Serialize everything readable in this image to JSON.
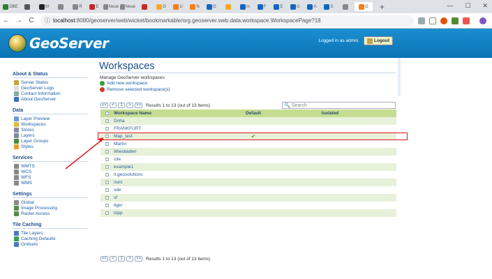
{
  "browser": {
    "tabs": [
      {
        "label": "DBE",
        "color": "#2e7d32"
      },
      {
        "label": "",
        "color": "#555"
      },
      {
        "label": "M",
        "color": "#222"
      },
      {
        "label": "",
        "color": "#888"
      },
      {
        "label": "R",
        "color": "#888"
      },
      {
        "label": "E",
        "color": "#c62828"
      },
      {
        "label": "Neue",
        "color": "#888"
      },
      {
        "label": "Neue",
        "color": "#888"
      },
      {
        "label": "",
        "color": "#c62828"
      },
      {
        "label": "D",
        "color": "#f9a825"
      },
      {
        "label": "U",
        "color": "#f57f17"
      },
      {
        "label": "N",
        "color": "#f57f17"
      },
      {
        "label": "G",
        "color": "#1565c0"
      },
      {
        "label": "",
        "color": "#f9a825"
      },
      {
        "label": "m",
        "color": "#1565c0"
      },
      {
        "label": "F",
        "color": "#1565c0"
      },
      {
        "label": "E",
        "color": "#1565c0"
      },
      {
        "label": "G",
        "color": "#1565c0"
      },
      {
        "label": "A",
        "color": "#1565c0"
      },
      {
        "label": "S",
        "color": "#1565c0"
      },
      {
        "label": "",
        "color": "#888"
      },
      {
        "label": "G",
        "color": "#f57f17"
      }
    ],
    "active_tab_label": "",
    "new_tab": "+",
    "window_controls": [
      "—",
      "☐",
      "✕"
    ],
    "nav": {
      "back": "←",
      "forward": "→",
      "reload": "C"
    },
    "url_host": "localhost",
    "url_rest": ":8080/geoserver/web/wicket/bookmarkable/org.geoserver.web.data.workspace.WorkspacePage?18"
  },
  "header": {
    "brand": "GeoServer",
    "login_text": "Logged in as admin.",
    "logout_label": "Logout"
  },
  "sidebar": {
    "sections": [
      {
        "title": "About & Status",
        "items": [
          {
            "label": "Server Status",
            "icon": "server-icon",
            "color": "#c8a040"
          },
          {
            "label": "GeoServer Logs",
            "icon": "log-icon",
            "color": "#ddd"
          },
          {
            "label": "Contact Information",
            "icon": "contact-icon",
            "color": "#8aa"
          },
          {
            "label": "About GeoServer",
            "icon": "info-icon",
            "color": "#3a6ec0"
          }
        ]
      },
      {
        "title": "Data",
        "items": [
          {
            "label": "Layer Preview",
            "icon": "preview-icon",
            "color": "#6a9ad0"
          },
          {
            "label": "Workspaces",
            "icon": "folder-icon",
            "color": "#e0b840"
          },
          {
            "label": "Stores",
            "icon": "store-icon",
            "color": "#8a8aa0"
          },
          {
            "label": "Layers",
            "icon": "layers-icon",
            "color": "#7a8aa0"
          },
          {
            "label": "Layer Groups",
            "icon": "layer-group-icon",
            "color": "#4a8a3a"
          },
          {
            "label": "Styles",
            "icon": "styles-icon",
            "color": "#e0a030"
          }
        ]
      },
      {
        "title": "Services",
        "items": [
          {
            "label": "WMTS",
            "icon": "service-icon",
            "color": "#888"
          },
          {
            "label": "WCS",
            "icon": "service-icon",
            "color": "#888"
          },
          {
            "label": "WFS",
            "icon": "service-icon",
            "color": "#888"
          },
          {
            "label": "WMS",
            "icon": "service-icon",
            "color": "#888"
          }
        ]
      },
      {
        "title": "Settings",
        "items": [
          {
            "label": "Global",
            "icon": "global-icon",
            "color": "#888"
          },
          {
            "label": "Image Processing",
            "icon": "image-icon",
            "color": "#5a8a4a"
          },
          {
            "label": "Raster Access",
            "icon": "raster-icon",
            "color": "#5a8a4a"
          }
        ]
      },
      {
        "title": "Tile Caching",
        "items": [
          {
            "label": "Tile Layers",
            "icon": "tile-icon",
            "color": "#4a7ac0"
          },
          {
            "label": "Caching Defaults",
            "icon": "globe-icon",
            "color": "#3a9a5a"
          },
          {
            "label": "Gridsets",
            "icon": "grid-icon",
            "color": "#4a7ac0"
          }
        ]
      }
    ]
  },
  "main": {
    "title": "Workspaces",
    "description": "Manage GeoServer workspaces",
    "add_label": "Add new workspace",
    "remove_label": "Remove selected workspace(s)",
    "pager": {
      "first": "<<",
      "prev": "<",
      "page": "1",
      "next": ">",
      "last": ">>",
      "summary": "Results 1 to 13 (out of 13 items)"
    },
    "search_placeholder": "Search",
    "columns": {
      "name": "Workspace Name",
      "default": "Default",
      "isolated": "Isolated"
    },
    "rows": [
      {
        "name": "Doha",
        "default": ""
      },
      {
        "name": "FRANKFURT",
        "default": ""
      },
      {
        "name": "Map_test",
        "default": "✔"
      },
      {
        "name": "Martin",
        "default": ""
      },
      {
        "name": "Wiesbaden",
        "default": ""
      },
      {
        "name": "cite",
        "default": ""
      },
      {
        "name": "example1",
        "default": ""
      },
      {
        "name": "it.geosolutions",
        "default": ""
      },
      {
        "name": "nurc",
        "default": ""
      },
      {
        "name": "sde",
        "default": ""
      },
      {
        "name": "sf",
        "default": ""
      },
      {
        "name": "tiger",
        "default": ""
      },
      {
        "name": "topp",
        "default": ""
      }
    ]
  },
  "colors": {
    "highlight": "#e0141c",
    "accent": "#1b8fd0",
    "header_row": "#c4dd91",
    "even_row": "#e7f1d9"
  }
}
